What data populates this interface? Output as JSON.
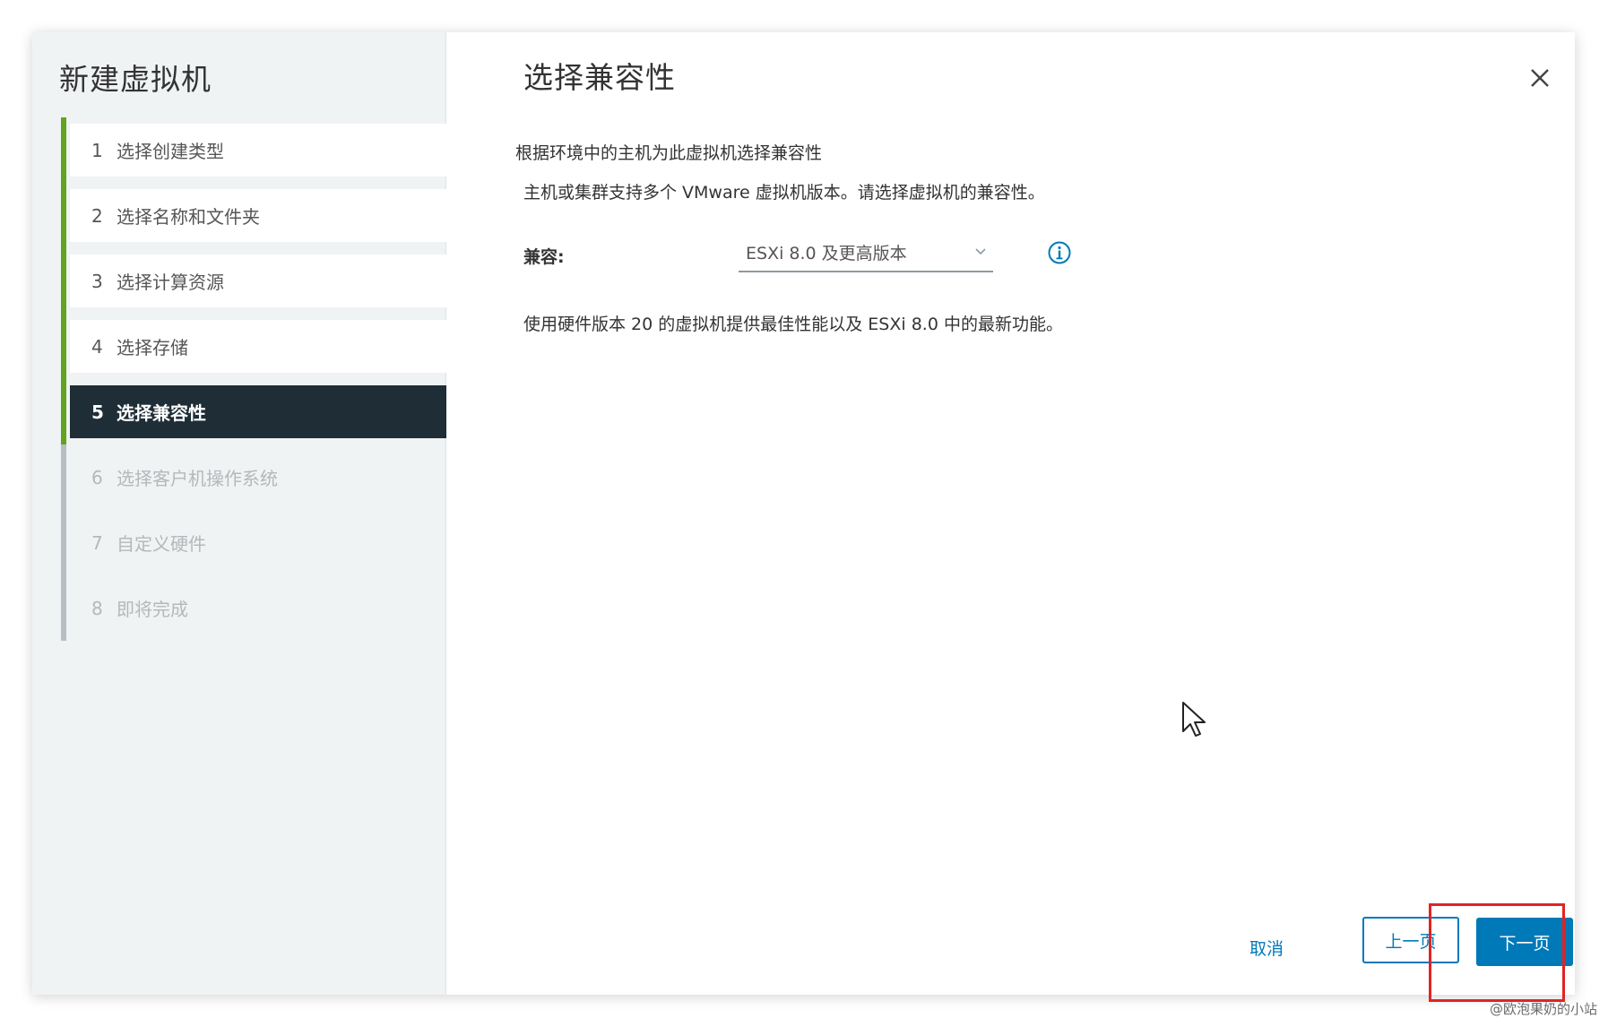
{
  "sidebar": {
    "title": "新建虚拟机",
    "steps": [
      {
        "num": "1",
        "label": "选择创建类型",
        "state": "done"
      },
      {
        "num": "2",
        "label": "选择名称和文件夹",
        "state": "done"
      },
      {
        "num": "3",
        "label": "选择计算资源",
        "state": "done"
      },
      {
        "num": "4",
        "label": "选择存储",
        "state": "done"
      },
      {
        "num": "5",
        "label": "选择兼容性",
        "state": "active"
      },
      {
        "num": "6",
        "label": "选择客户机操作系统",
        "state": "pending"
      },
      {
        "num": "7",
        "label": "自定义硬件",
        "state": "pending"
      },
      {
        "num": "8",
        "label": "即将完成",
        "state": "pending"
      }
    ]
  },
  "main": {
    "title": "选择兼容性",
    "subtitle": "根据环境中的主机为此虚拟机选择兼容性",
    "description": "主机或集群支持多个 VMware 虚拟机版本。请选择虚拟机的兼容性。",
    "compat_label": "兼容:",
    "compat_value": "ESXi 8.0 及更高版本",
    "note": "使用硬件版本 20 的虚拟机提供最佳性能以及 ESXi 8.0 中的最新功能。"
  },
  "footer": {
    "cancel_label": "取消",
    "back_label": "上一页",
    "next_label": "下一页"
  },
  "watermark": "@欧泡果奶的小站",
  "icons": {
    "close": "close-icon",
    "info": "info-icon",
    "dropdown": "chevron-down-icon",
    "cursor": "mouse-cursor-icon"
  },
  "colors": {
    "accent": "#0079b8",
    "done_bar": "#62a420",
    "active_step_bg": "#1e2d36",
    "highlight": "#e02424"
  }
}
